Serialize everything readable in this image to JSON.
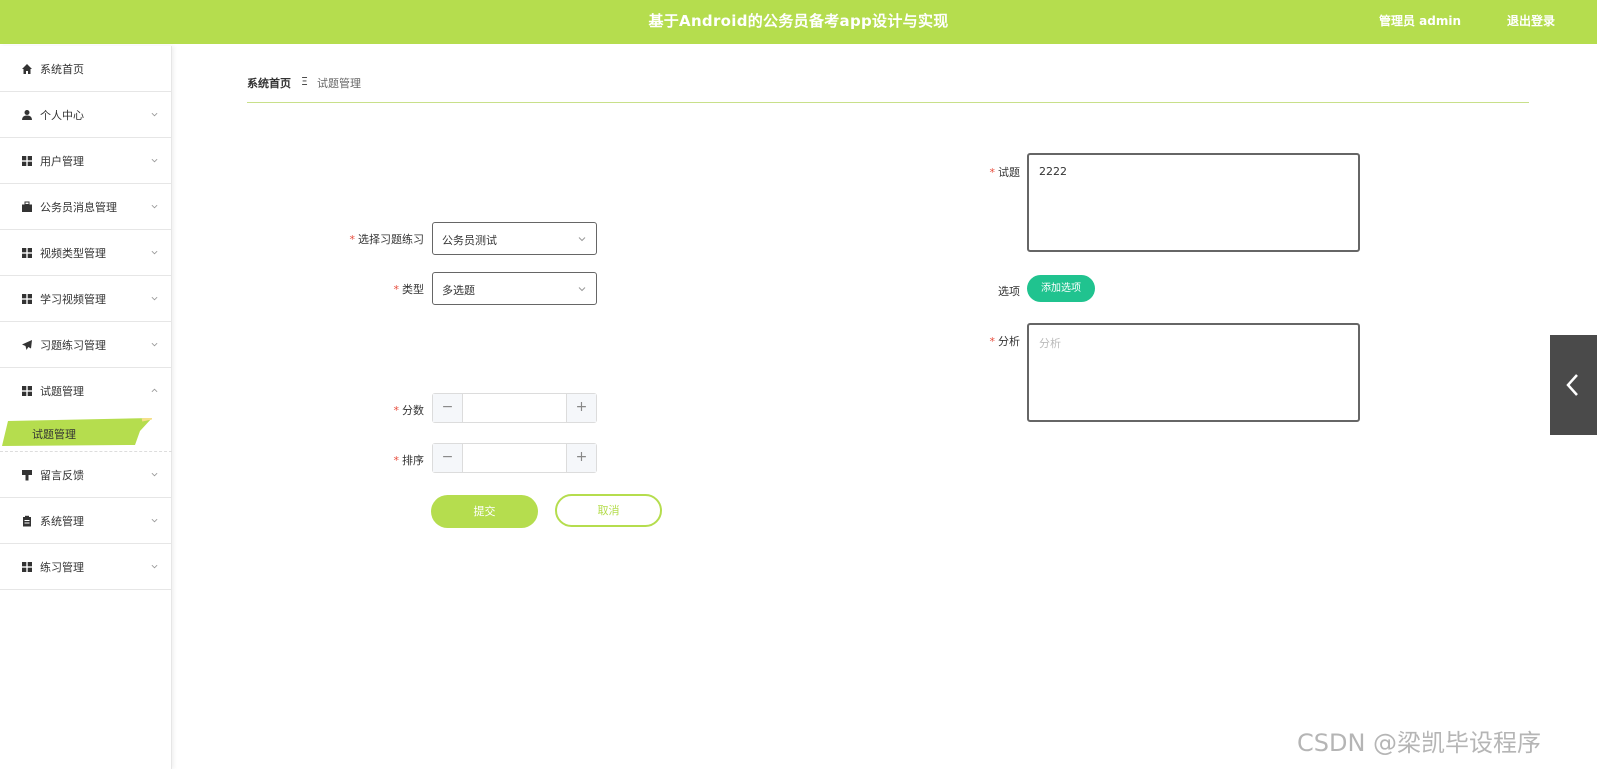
{
  "header": {
    "title": "基于Android的公务员备考app设计与实现",
    "admin_label": "管理员 admin",
    "logout_label": "退出登录",
    "accent_color": "#b5dd4e"
  },
  "sidebar": {
    "items": [
      {
        "label": "系统首页",
        "icon": "home-icon"
      },
      {
        "label": "个人中心",
        "icon": "person-icon"
      },
      {
        "label": "用户管理",
        "icon": "grid-icon"
      },
      {
        "label": "公务员消息管理",
        "icon": "briefcase-icon"
      },
      {
        "label": "视频类型管理",
        "icon": "grid-icon"
      },
      {
        "label": "学习视频管理",
        "icon": "grid-icon"
      },
      {
        "label": "习题练习管理",
        "icon": "paper-plane-icon"
      },
      {
        "label": "试题管理",
        "icon": "grid-icon"
      },
      {
        "label": "留言反馈",
        "icon": "brush-icon"
      },
      {
        "label": "系统管理",
        "icon": "clipboard-icon"
      },
      {
        "label": "练习管理",
        "icon": "grid-icon"
      }
    ],
    "active_sub_item": "试题管理"
  },
  "breadcrumb": {
    "home": "系统首页",
    "separator": "Ξ",
    "current": "试题管理"
  },
  "form": {
    "practice_label": "选择习题练习",
    "practice_value": "公务员测试",
    "type_label": "类型",
    "type_value": "多选题",
    "score_label": "分数",
    "score_value": "",
    "sort_label": "排序",
    "sort_value": "",
    "question_label": "试题",
    "question_value": "2222",
    "options_label": "选项",
    "add_option_button": "添加选项",
    "analysis_label": "分析",
    "analysis_placeholder": "分析",
    "analysis_value": "",
    "submit_button": "提交",
    "cancel_button": "取消",
    "minus": "−",
    "plus": "+"
  },
  "watermark": "CSDN @梁凯毕设程序"
}
